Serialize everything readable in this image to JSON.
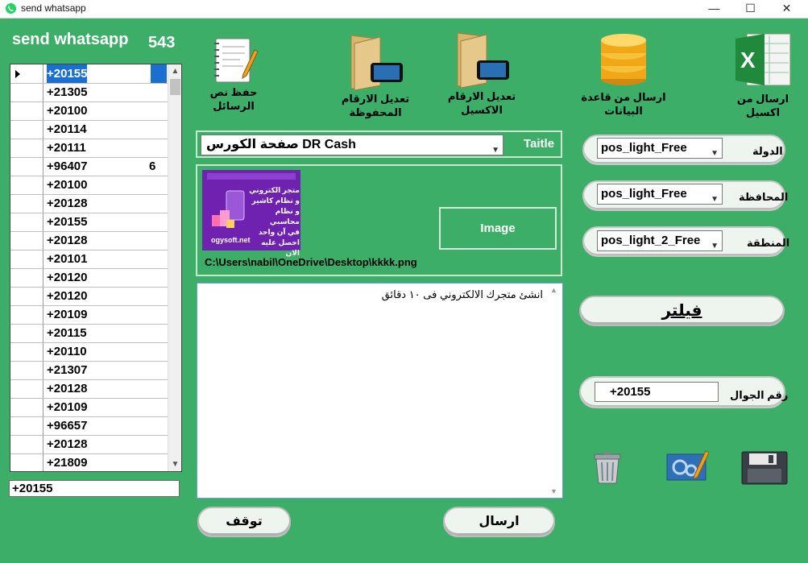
{
  "window": {
    "title": "send whatsapp",
    "minimize": "—",
    "maximize": "☐",
    "close": "✕"
  },
  "header": {
    "app_title": "send whatsapp",
    "count": "543"
  },
  "grid": {
    "rows": [
      {
        "num": "+20155",
        "tail": ""
      },
      {
        "num": "+21305",
        "tail": ""
      },
      {
        "num": "+20100",
        "tail": ""
      },
      {
        "num": "+20114",
        "tail": ""
      },
      {
        "num": "+20111",
        "tail": ""
      },
      {
        "num": "+96407",
        "tail": "6"
      },
      {
        "num": "+20100",
        "tail": ""
      },
      {
        "num": "+20128",
        "tail": ""
      },
      {
        "num": "+20155",
        "tail": ""
      },
      {
        "num": "+20128",
        "tail": ""
      },
      {
        "num": "+20101",
        "tail": ""
      },
      {
        "num": "+20120",
        "tail": ""
      },
      {
        "num": "+20120",
        "tail": ""
      },
      {
        "num": "+20109",
        "tail": ""
      },
      {
        "num": "+20115",
        "tail": ""
      },
      {
        "num": "+20110",
        "tail": ""
      },
      {
        "num": "+21307",
        "tail": ""
      },
      {
        "num": "+20128",
        "tail": ""
      },
      {
        "num": "+20109",
        "tail": ""
      },
      {
        "num": "+96657",
        "tail": ""
      },
      {
        "num": "+20128",
        "tail": ""
      },
      {
        "num": "+21809",
        "tail": ""
      }
    ]
  },
  "phone_filter_value": "+20155",
  "toolbar": {
    "save_text": "حفظ نص الرسائل",
    "edit_saved": [
      "تعديل الارقام",
      "المحفوظة"
    ],
    "edit_excel": [
      "تعديل الارقام",
      "الاكسيل"
    ],
    "send_db": "ارسال من قاعدة البيانات",
    "send_excel": "ارسال من اكسيل"
  },
  "title_row": {
    "value": "صفحة الكورس DR Cash",
    "label": "Taitle"
  },
  "image_panel": {
    "path": "C:\\Users\\nabil\\OneDrive\\Desktop\\kkkk.png",
    "button": "Image",
    "thumb_lines": [
      "متجر الكتروني",
      "و نظام كاشير",
      "و نظام محاسبي",
      "في آن واحد",
      "احصل عليه الان"
    ],
    "thumb_site": "ogysoft.net"
  },
  "message": "انشئ متجرك الالكتروني فى ١٠ دقائق",
  "filters": {
    "country": {
      "label": "الدولة",
      "value": "pos_light_Free"
    },
    "governorate": {
      "label": "المحافظة",
      "value": "pos_light_Free"
    },
    "area": {
      "label": "المنطقة",
      "value": "pos_light_2_Free"
    }
  },
  "filter_button": "فيلتر",
  "mobile": {
    "label": "رقم الجوال",
    "value": "+20155"
  },
  "actions": {
    "stop": "توقف",
    "send": "ارسال"
  },
  "colors": {
    "background": "#3dae67",
    "selection": "#1a6fd0",
    "thumb": "#6f22b0"
  }
}
